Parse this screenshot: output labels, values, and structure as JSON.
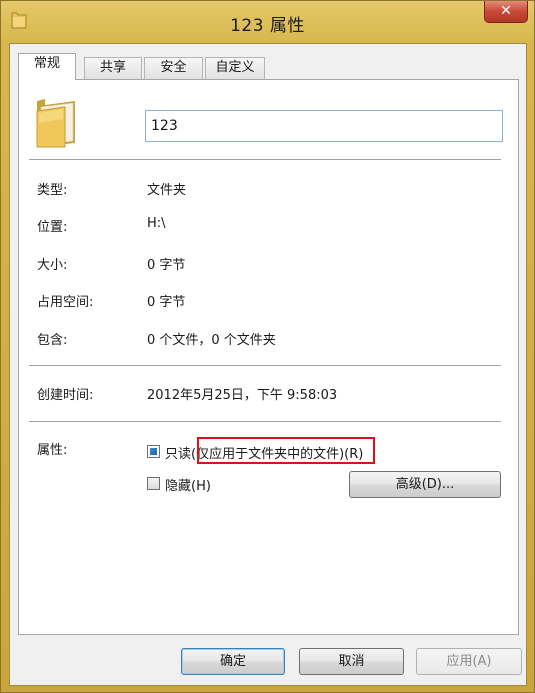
{
  "window": {
    "title": "123 属性",
    "close_label": "✕"
  },
  "tabs": [
    {
      "label": "常规",
      "active": true
    },
    {
      "label": "共享",
      "active": false
    },
    {
      "label": "安全",
      "active": false
    },
    {
      "label": "自定义",
      "active": false
    }
  ],
  "general": {
    "folder_name": "123",
    "type_label": "类型:",
    "type_value": "文件夹",
    "location_label": "位置:",
    "location_value": "H:\\",
    "size_label": "大小:",
    "size_value": "0 字节",
    "disk_size_label": "占用空间:",
    "disk_size_value": "0 字节",
    "contains_label": "包含:",
    "contains_value": "0 个文件，0 个文件夹",
    "created_label": "创建时间:",
    "created_value": "2012年5月25日，下午 9:58:03",
    "attributes_label": "属性:",
    "readonly_label_prefix": "只读",
    "readonly_label_highlight": "(仅应用于文件夹中的文件)",
    "readonly_label_suffix": "(R)",
    "readonly_checked": true,
    "hidden_label": "隐藏(H)",
    "hidden_checked": false,
    "advanced_button": "高级(D)..."
  },
  "footer": {
    "ok": "确定",
    "cancel": "取消",
    "apply": "应用(A)"
  },
  "colors": {
    "title_bar": "#d8b84e",
    "close_button": "#c74a37",
    "highlight_box": "#e0101a",
    "input_border": "#8bb2d6"
  },
  "icons": {
    "title": "folder-icon",
    "main": "folder-icon"
  }
}
